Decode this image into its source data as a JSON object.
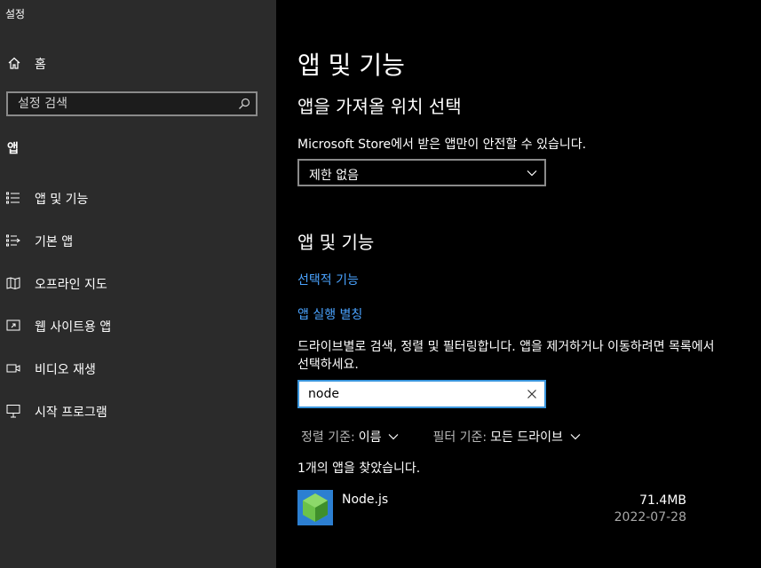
{
  "window": {
    "title": "설정"
  },
  "sidebar": {
    "home_label": "홈",
    "search_placeholder": "설정 검색",
    "section": "앱",
    "items": [
      {
        "label": "앱 및 기능",
        "icon": "list-icon"
      },
      {
        "label": "기본 앱",
        "icon": "default-apps-icon"
      },
      {
        "label": "오프라인 지도",
        "icon": "map-icon"
      },
      {
        "label": "웹 사이트용 앱",
        "icon": "web-apps-icon"
      },
      {
        "label": "비디오 재생",
        "icon": "video-icon"
      },
      {
        "label": "시작 프로그램",
        "icon": "startup-icon"
      }
    ]
  },
  "main": {
    "title": "앱 및 기능",
    "source_heading": "앱을 가져올 위치 선택",
    "source_desc": "Microsoft Store에서 받은 앱만이 안전할 수 있습니다.",
    "source_value": "제한 없음",
    "apps_heading": "앱 및 기능",
    "link_optional": "선택적 기능",
    "link_aliases": "앱 실행 별칭",
    "search_desc": "드라이브별로 검색, 정렬 및 필터링합니다. 앱을 제거하거나 이동하려면 목록에서 선택하세요.",
    "search_value": "node",
    "sort_key": "정렬 기준:",
    "sort_value": "이름",
    "filter_key": "필터 기준:",
    "filter_value": "모든 드라이브",
    "found_text": "1개의 앱을 찾았습니다.",
    "apps": [
      {
        "name": "Node.js",
        "size": "71.4MB",
        "date": "2022-07-28"
      }
    ]
  },
  "colors": {
    "accent": "#3a96dd",
    "link": "#4aa3ff",
    "sidebar_bg": "#2b2b2b",
    "main_bg": "#000000"
  }
}
